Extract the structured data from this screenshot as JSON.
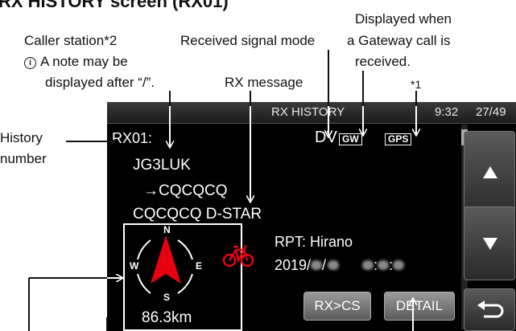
{
  "page_title": "RX HISTORY screen (RX01)",
  "callouts": {
    "caller_station": "Caller station*2",
    "note_line1": "A note may be",
    "note_line2": "displayed after “/”.",
    "received_signal_mode": "Received signal mode",
    "gateway_line1": "Displayed when",
    "gateway_line2": "a Gateway call is",
    "gateway_line3": "received.",
    "rx_message": "RX message",
    "footnote_star1": "*1",
    "history_line1": "History",
    "history_line2": "number"
  },
  "screen": {
    "title": "RX HISTORY",
    "time": "9:32",
    "count": "27/49",
    "history_number": "RX01:",
    "mode": "DV",
    "gw_badge": "GW",
    "gps_badge": "GPS",
    "caller": "JG3LUK",
    "to_call": "→CQCQCQ",
    "message": "CQCQCQ D-STAR",
    "rpt": "RPT: Hirano",
    "date_prefix": "2019/",
    "compass": {
      "n": "N",
      "s": "S",
      "e": "E",
      "w": "W"
    },
    "distance": "86.3km",
    "btn_rxcs": "RX>CS",
    "btn_detail": "DETAIL",
    "up_icon": "up-arrow-icon",
    "down_icon": "down-arrow-icon",
    "return_icon": "return-icon"
  },
  "colors": {
    "screen_bg": "#000000",
    "compass_arrow": "#e60012",
    "bike": "#e60012"
  }
}
